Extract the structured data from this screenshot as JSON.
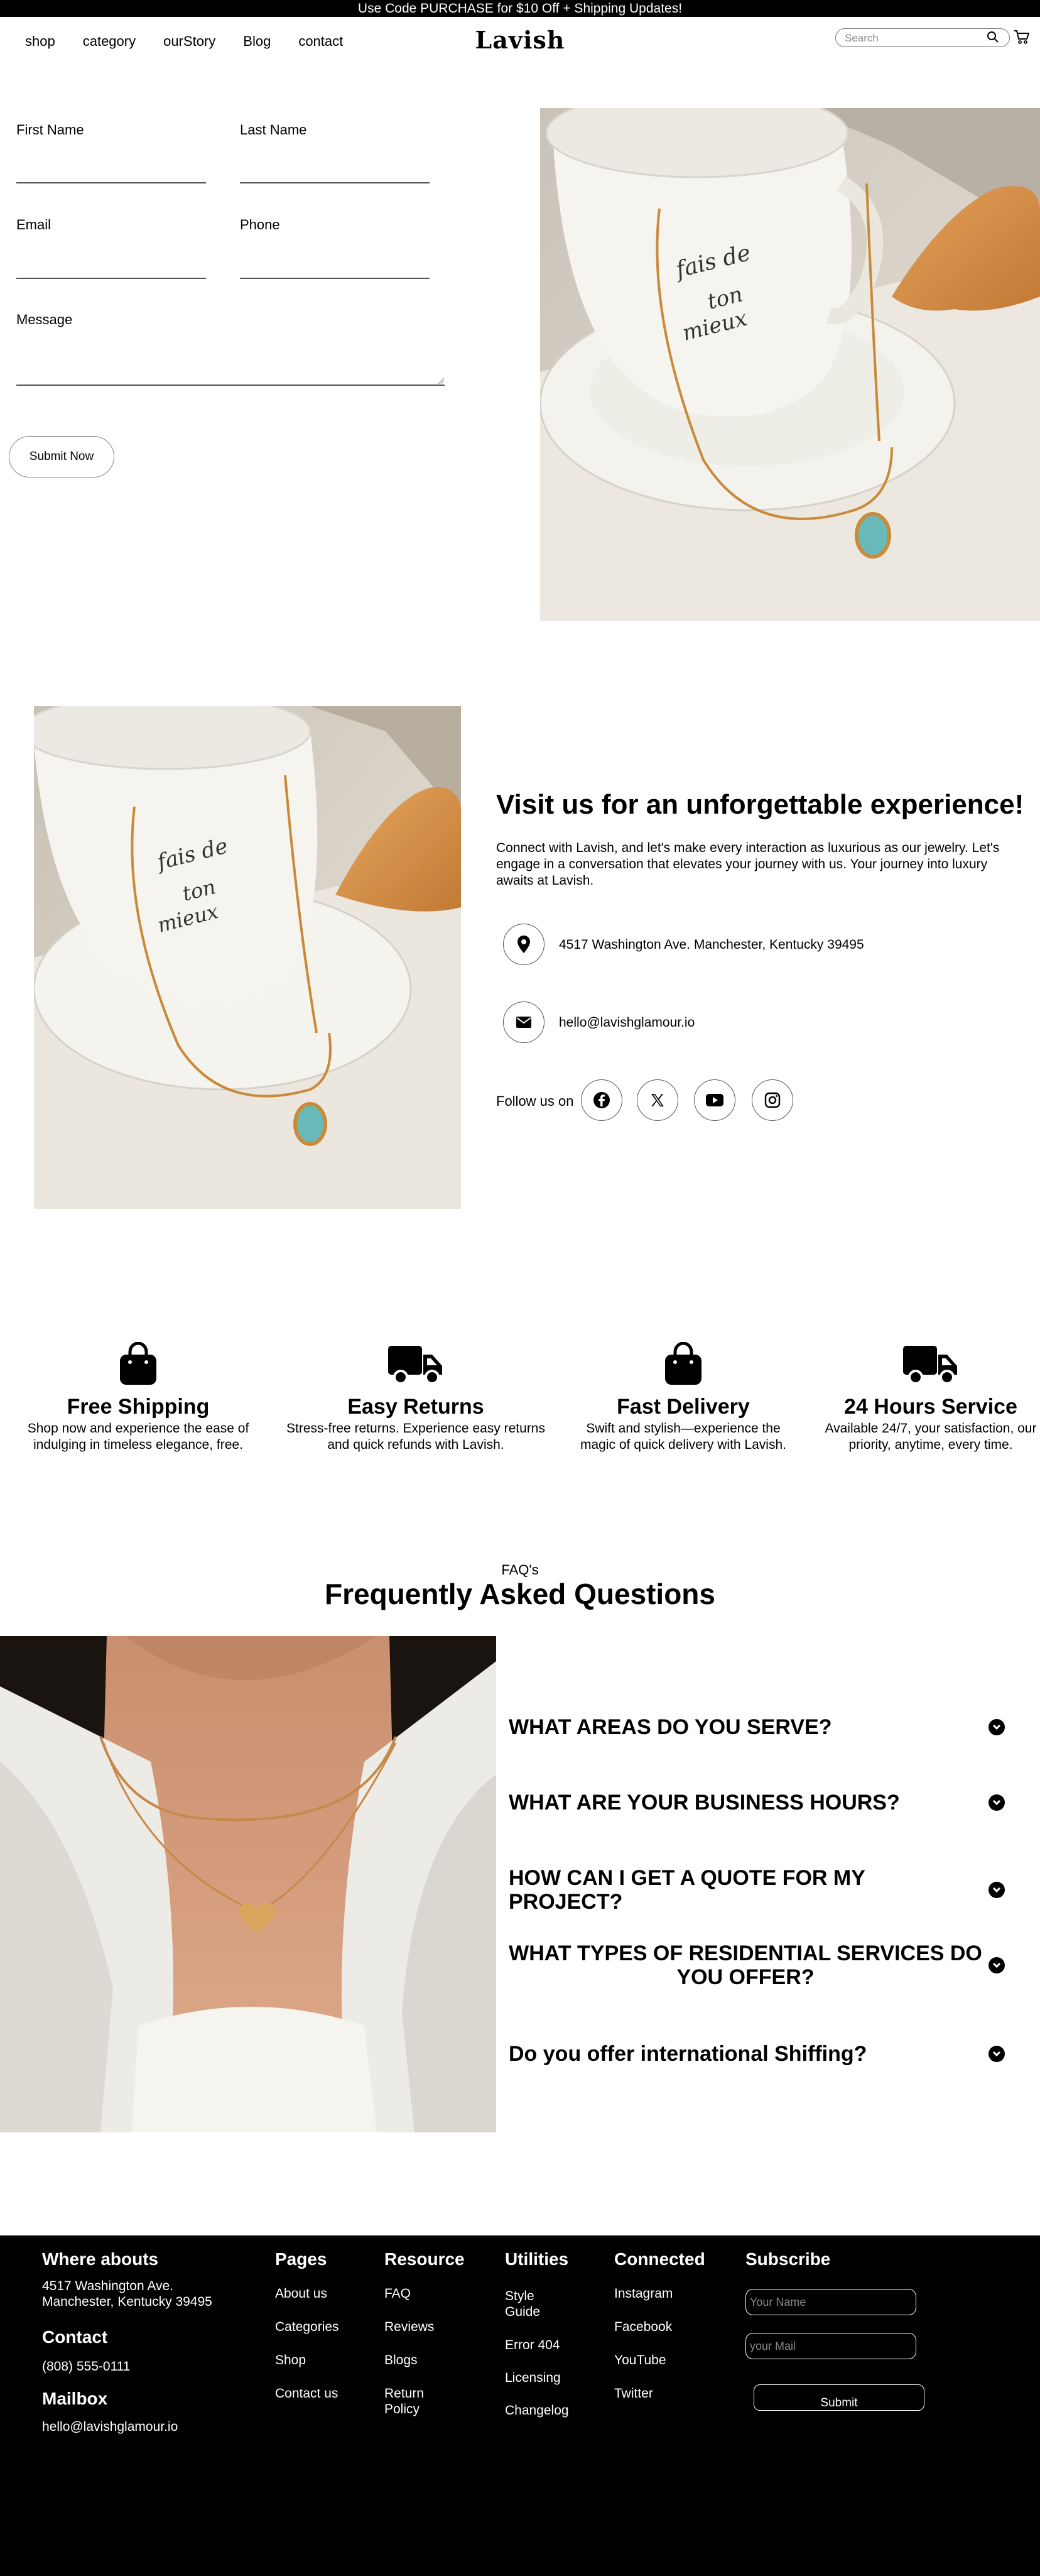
{
  "announcement": "Use Code PURCHASE for $10 Off + Shipping Updates!",
  "nav": {
    "links": [
      "shop",
      "category",
      "ourStory",
      "Blog",
      "contact"
    ],
    "logo": "Lavish",
    "search_placeholder": "Search"
  },
  "contact_form": {
    "first_name_label": "First Name",
    "last_name_label": "Last Name",
    "email_label": "Email",
    "phone_label": "Phone",
    "message_label": "Message",
    "submit_label": "Submit Now"
  },
  "visit": {
    "title": "Visit us for an unforgettable experience!",
    "text": "Connect with Lavish, and let's make every interaction as luxurious as our jewelry. Let's engage in a conversation that elevates your journey with us. Your journey into luxury awaits at Lavish.",
    "address": "4517 Washington Ave. Manchester, Kentucky 39495",
    "email": "hello@lavishglamour.io",
    "follow_label": "Follow us on"
  },
  "features": [
    {
      "icon": "shopping-bag-icon",
      "title": "Free Shipping",
      "text": "Shop now and experience the ease of indulging in timeless elegance, free."
    },
    {
      "icon": "truck-icon",
      "title": "Easy Returns",
      "text": "Stress-free returns. Experience easy returns and quick refunds with Lavish."
    },
    {
      "icon": "shopping-bag-icon",
      "title": "Fast Delivery",
      "text": "Swift and stylish—experience the magic of quick delivery with Lavish."
    },
    {
      "icon": "truck-icon",
      "title": "24 Hours Service",
      "text": "Available 24/7, your satisfaction, our priority, anytime, every time."
    }
  ],
  "faq": {
    "kicker": "FAQ's",
    "title": "Frequently Asked Questions",
    "questions": [
      "WHAT AREAS DO YOU SERVE?",
      "WHAT ARE YOUR BUSINESS HOURS?",
      "HOW CAN I GET A QUOTE FOR MY PROJECT?",
      "WHAT TYPES OF RESIDENTIAL SERVICES DO YOU OFFER?",
      "Do you offer international Shiffing?"
    ]
  },
  "footer": {
    "where_title": "Where abouts",
    "where_address": "4517 Washington Ave. Manchester, Kentucky 39495",
    "contact_title": "Contact",
    "phone": "(808) 555-0111",
    "mailbox_title": "Mailbox",
    "mail": "hello@lavishglamour.io",
    "columns": [
      {
        "title": "Pages",
        "items": [
          "About us",
          "Categories",
          "Shop",
          "Contact us"
        ]
      },
      {
        "title": "Resource",
        "items": [
          "FAQ",
          "Reviews",
          "Blogs",
          "Return Policy"
        ]
      },
      {
        "title": "Utilities",
        "items": [
          "Style Guide",
          "Error 404",
          "Licensing",
          "Changelog"
        ]
      },
      {
        "title": "Connected",
        "items": [
          "Instagram",
          "Facebook",
          "YouTube",
          "Twitter"
        ]
      }
    ],
    "subscribe_title": "Subscribe",
    "name_placeholder": "Your Name",
    "mail_placeholder": "your Mail",
    "submit_label": "Submit"
  }
}
